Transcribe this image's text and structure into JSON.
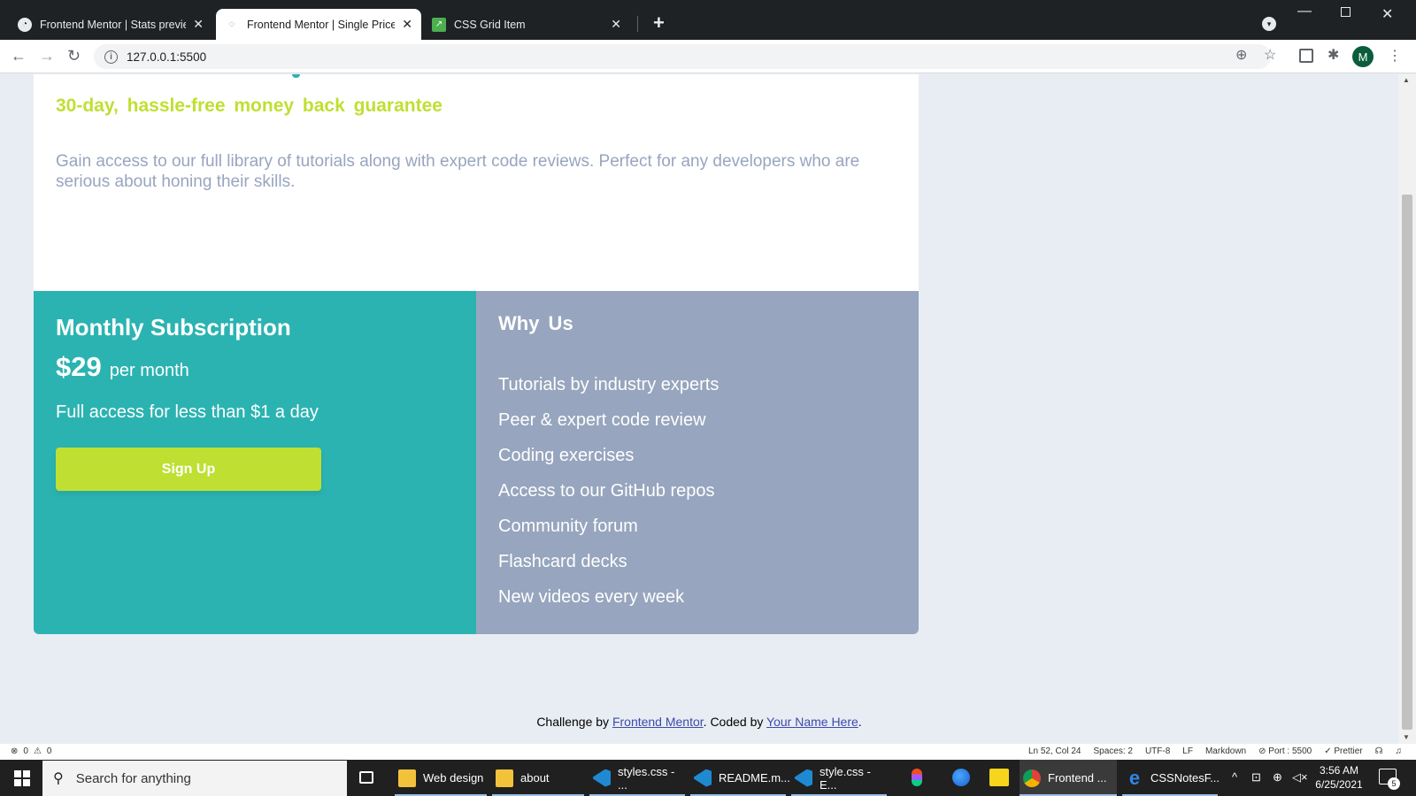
{
  "browser": {
    "tabs": [
      {
        "title": "Frontend Mentor | Stats preview",
        "active": false
      },
      {
        "title": "Frontend Mentor | Single Price G",
        "active": true
      },
      {
        "title": "CSS Grid Item",
        "active": false
      }
    ],
    "url": "127.0.0.1:5500",
    "profile_initial": "M"
  },
  "page": {
    "guarantee": "30-day, hassle-free money back guarantee",
    "description": "Gain access to our full library of tutorials along with expert code reviews. Perfect for any developers who are serious about honing their skills.",
    "subscription": {
      "title": "Monthly Subscription",
      "price": "$29",
      "price_unit": "per month",
      "description": "Full access for less than $1 a day",
      "cta": "Sign Up"
    },
    "why_us": {
      "title": "Why Us",
      "items": [
        "Tutorials by industry experts",
        "Peer & expert code review",
        "Coding exercises",
        "Access to our GitHub repos",
        "Community forum",
        "Flashcard decks",
        "New videos every week"
      ]
    },
    "attribution": {
      "prefix": "Challenge by ",
      "link1": "Frontend Mentor",
      "middle": ". Coded by ",
      "link2": "Your Name Here",
      "suffix": "."
    },
    "colors": {
      "teal": "#2bb3b1",
      "lime": "#bfdf32",
      "grayish_blue": "#97a5be",
      "background": "#e8edf4"
    }
  },
  "statusbar": {
    "errors": "0",
    "warnings": "0",
    "position": "Ln 52, Col 24",
    "spaces": "Spaces: 2",
    "encoding": "UTF-8",
    "eol": "LF",
    "language": "Markdown",
    "port": "Port : 5500",
    "prettier": "Prettier"
  },
  "taskbar": {
    "search_placeholder": "Search for anything",
    "items": [
      {
        "label": "Web design",
        "icon": "folder-icon"
      },
      {
        "label": "about",
        "icon": "folder-icon"
      },
      {
        "label": "styles.css - ...",
        "icon": "vscode-icon"
      },
      {
        "label": "README.m...",
        "icon": "vscode-icon"
      },
      {
        "label": "style.css - E...",
        "icon": "vscode-icon"
      },
      {
        "label": "Frontend ...",
        "icon": "chrome-icon"
      },
      {
        "label": "CSSNotesF...",
        "icon": "edge-icon"
      }
    ],
    "time": "3:56 AM",
    "date": "6/25/2021",
    "notification_count": "5"
  }
}
